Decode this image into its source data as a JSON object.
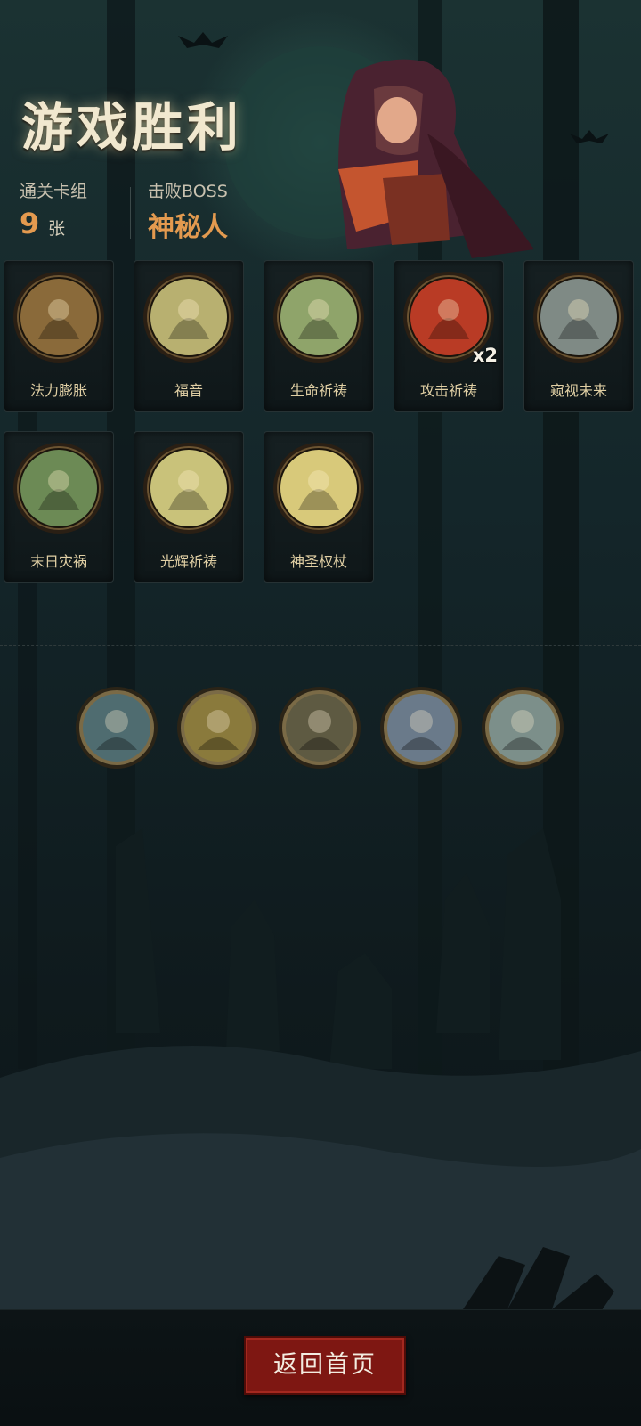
{
  "header": {
    "title": "游戏胜利",
    "deck_label": "通关卡组",
    "deck_count": "9",
    "deck_unit": "张",
    "boss_label": "击败BOSS",
    "boss_name": "神秘人"
  },
  "cards": [
    {
      "name": "法力膨胀",
      "icon": "mage-casting-icon",
      "tone": "#8a6a3a"
    },
    {
      "name": "福音",
      "icon": "holy-cross-icon",
      "tone": "#b8b070"
    },
    {
      "name": "生命祈祷",
      "icon": "sprout-icon",
      "tone": "#8fa46a"
    },
    {
      "name": "攻击祈祷",
      "icon": "fire-claw-icon",
      "tone": "#b93b25",
      "badge": "x2"
    },
    {
      "name": "窥视未来",
      "icon": "spiral-staff-icon",
      "tone": "#7f8a85"
    },
    {
      "name": "末日灾祸",
      "icon": "red-blaze-icon",
      "tone": "#6c8a55"
    },
    {
      "name": "光辉祈祷",
      "icon": "hooded-priest-icon",
      "tone": "#c9c27a"
    },
    {
      "name": "神圣权杖",
      "icon": "holy-scepter-icon",
      "tone": "#d8c97a"
    }
  ],
  "relics": [
    {
      "icon": "crescent-moon-icon"
    },
    {
      "icon": "golden-angel-icon"
    },
    {
      "icon": "bearded-sage-icon"
    },
    {
      "icon": "screaming-man-icon"
    },
    {
      "icon": "poker-cards-icon"
    }
  ],
  "footer": {
    "home_button": "返回首页"
  },
  "colors": {
    "accent_orange": "#e39a4f",
    "button_red": "#7e1712",
    "card_label": "#e0cfa4"
  }
}
